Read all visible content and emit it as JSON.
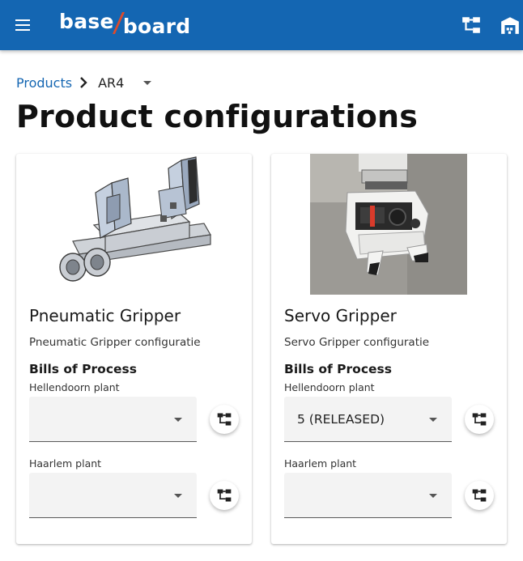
{
  "app": {
    "logo_part1": "base",
    "logo_part2": "board",
    "colors": {
      "appbar": "#1466b2",
      "logo_slash": "#e04b2a",
      "link": "#1466b2"
    },
    "icons": [
      "menu-icon",
      "hierarchy-icon",
      "warehouse-icon"
    ]
  },
  "breadcrumb": {
    "root": "Products",
    "current": "AR4"
  },
  "page": {
    "title": "Product configurations"
  },
  "cards": [
    {
      "title": "Pneumatic Gripper",
      "subtitle": "Pneumatic Gripper configuratie",
      "section": "Bills of Process",
      "fields": [
        {
          "label": "Hellendoorn plant",
          "value": ""
        },
        {
          "label": "Haarlem plant",
          "value": ""
        }
      ]
    },
    {
      "title": "Servo Gripper",
      "subtitle": "Servo Gripper configuratie",
      "section": "Bills of Process",
      "fields": [
        {
          "label": "Hellendoorn plant",
          "value": "5 (RELEASED)"
        },
        {
          "label": "Haarlem plant",
          "value": ""
        }
      ]
    }
  ]
}
